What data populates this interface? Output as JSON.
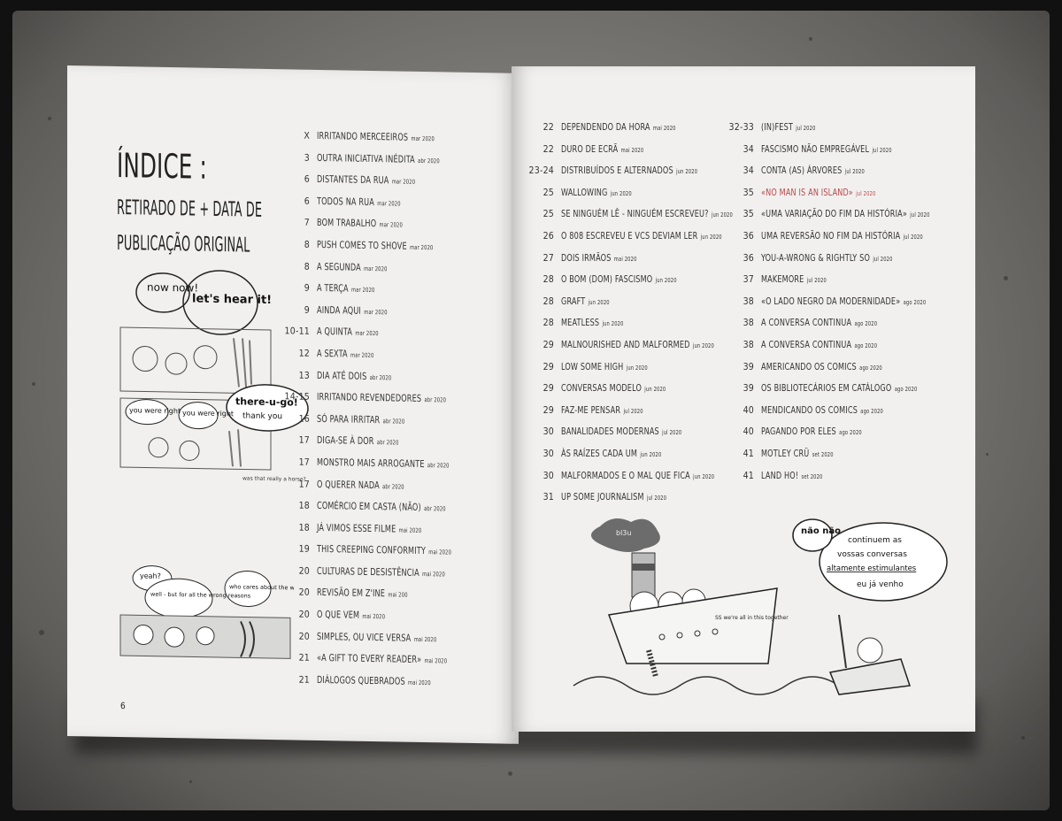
{
  "left_page": {
    "title": "ÍNDICE :",
    "subtitle_line1": "RETIRADO DE + DATA DE",
    "subtitle_line2": "PUBLICAÇÃO ORIGINAL",
    "page_number": "6",
    "comic_speech": {
      "now_now": "now now!",
      "lets_hear": "let's hear it!",
      "there_u_go": "there-u-go!",
      "thank_you": "thank you",
      "you_were_right": "you were right",
      "you_were_right_2": "you were right",
      "was_that": "was that really a horse?",
      "yeah": "yeah?",
      "well": "well - but for all the wrong reasons",
      "who_cares": "who cares about the whip"
    },
    "entries": [
      {
        "num": "X",
        "title": "Irritando merceeiros",
        "date": "mar 2020"
      },
      {
        "num": "3",
        "title": "Outra iniciativa inédita",
        "date": "abr 2020"
      },
      {
        "num": "6",
        "title": "Distantes da rua",
        "date": "mar 2020"
      },
      {
        "num": "6",
        "title": "Todos na rua",
        "date": "mar 2020"
      },
      {
        "num": "7",
        "title": "Bom trabalho",
        "date": "mar 2020"
      },
      {
        "num": "8",
        "title": "Push comes to shove",
        "date": "mar 2020"
      },
      {
        "num": "8",
        "title": "A segunda",
        "date": "mar 2020"
      },
      {
        "num": "9",
        "title": "A terça",
        "date": "mar 2020"
      },
      {
        "num": "9",
        "title": "Ainda aqui",
        "date": "mar 2020"
      },
      {
        "num": "10-11",
        "title": "A quinta",
        "date": "mar 2020"
      },
      {
        "num": "12",
        "title": "A sexta",
        "date": "mar 2020"
      },
      {
        "num": "13",
        "title": "Dia até dois",
        "date": "abr 2020"
      },
      {
        "num": "14-15",
        "title": "Irritando revendedores",
        "date": "abr 2020"
      },
      {
        "num": "16",
        "title": "Só para irritar",
        "date": "abr 2020"
      },
      {
        "num": "17",
        "title": "Diga-se à dor",
        "date": "abr 2020"
      },
      {
        "num": "17",
        "title": "Monstro mais arrogante",
        "date": "abr 2020"
      },
      {
        "num": "17",
        "title": "O querer nada",
        "date": "abr 2020"
      },
      {
        "num": "18",
        "title": "Comércio em casta (não)",
        "date": "abr 2020"
      },
      {
        "num": "18",
        "title": "Já vimos esse filme",
        "date": "mai 2020"
      },
      {
        "num": "19",
        "title": "This creeping conformity",
        "date": "mai 2020"
      },
      {
        "num": "20",
        "title": "Culturas de desistência",
        "date": "mai 2020"
      },
      {
        "num": "20",
        "title": "Revisão em Z'ine",
        "date": "mai 200"
      },
      {
        "num": "20",
        "title": "O que vem",
        "date": "mai 2020"
      },
      {
        "num": "20",
        "title": "Simples, ou vice versa",
        "date": "mai 2020"
      },
      {
        "num": "21",
        "title": "«A gift to every reader»",
        "date": "mai 2020"
      },
      {
        "num": "21",
        "title": "Diálogos quebrados",
        "date": "mai 2020"
      }
    ]
  },
  "right_page": {
    "col1": [
      {
        "num": "22",
        "title": "Dependendo da hora",
        "date": "mai 2020"
      },
      {
        "num": "22",
        "title": "Duro de ecrã",
        "date": "mai 2020"
      },
      {
        "num": "23-24",
        "title": "Distribuídos e alternados",
        "date": "jun 2020"
      },
      {
        "num": "25",
        "title": "Wallowing",
        "date": "jun 2020"
      },
      {
        "num": "25",
        "title": "Se ninguém lê - ninguém escreveu?",
        "date": "jun 2020"
      },
      {
        "num": "26",
        "title": "O 808 escreveu e vcs deviam ler",
        "date": "jun 2020"
      },
      {
        "num": "27",
        "title": "Dois irmãos",
        "date": "mai 2020"
      },
      {
        "num": "28",
        "title": "O bom (dom) fascismo",
        "date": "jun 2020"
      },
      {
        "num": "28",
        "title": "Graft",
        "date": "jun 2020"
      },
      {
        "num": "28",
        "title": "Meatless",
        "date": "jun 2020"
      },
      {
        "num": "29",
        "title": "Malnourished and malformed",
        "date": "jun 2020"
      },
      {
        "num": "29",
        "title": "Low some high",
        "date": "jun 2020"
      },
      {
        "num": "29",
        "title": "Conversas modelo",
        "date": "jun 2020"
      },
      {
        "num": "29",
        "title": "Faz-me pensar",
        "date": "jul 2020"
      },
      {
        "num": "30",
        "title": "Banalidades modernas",
        "date": "jul 2020"
      },
      {
        "num": "30",
        "title": "Às raízes cada um",
        "date": "jun 2020"
      },
      {
        "num": "30",
        "title": "Malformados e o mal que fica",
        "date": "jun 2020"
      },
      {
        "num": "31",
        "title": "Up some journalism",
        "date": "jul 2020"
      }
    ],
    "col2": [
      {
        "num": "32-33",
        "title": "(In)fest",
        "date": "jul 2020"
      },
      {
        "num": "34",
        "title": "Fascismo não empregável",
        "date": "jul 2020"
      },
      {
        "num": "34",
        "title": "Conta (as) árvores",
        "date": "jul 2020"
      },
      {
        "num": "35",
        "title": "«No man is an island»",
        "date": "jul 2020",
        "red": true
      },
      {
        "num": "35",
        "title": "«Uma variação do fim da história»",
        "date": "jul 2020"
      },
      {
        "num": "36",
        "title": "Uma reversão no fim da história",
        "date": "jul 2020"
      },
      {
        "num": "36",
        "title": "You-a-wrong & rightly so",
        "date": "jul 2020"
      },
      {
        "num": "37",
        "title": "Makemore",
        "date": "jul 2020"
      },
      {
        "num": "38",
        "title": "«O lado negro da modernidade»",
        "date": "ago 2020"
      },
      {
        "num": "38",
        "title": "A conversa continua",
        "date": "ago 2020"
      },
      {
        "num": "38",
        "title": "A conversa continua",
        "date": "ago 2020"
      },
      {
        "num": "39",
        "title": "Americando os comics",
        "date": "ago 2020"
      },
      {
        "num": "39",
        "title": "Os bibliotecários em catálogo",
        "date": "ago 2020"
      },
      {
        "num": "40",
        "title": "Mendicando os comics",
        "date": "ago 2020"
      },
      {
        "num": "40",
        "title": "Pagando por eles",
        "date": "ago 2020"
      },
      {
        "num": "41",
        "title": "Motley Crü",
        "date": "set 2020"
      },
      {
        "num": "41",
        "title": "Land Ho!",
        "date": "set 2020"
      }
    ],
    "comic_speech": {
      "nao_nao": "não não",
      "line1": "continuem as",
      "line2": "vossas conversas",
      "line3": "altamente estimulantes",
      "line4": "eu já venho",
      "ship_text": "SS we're all in this together",
      "smoke": "bl3u"
    }
  }
}
